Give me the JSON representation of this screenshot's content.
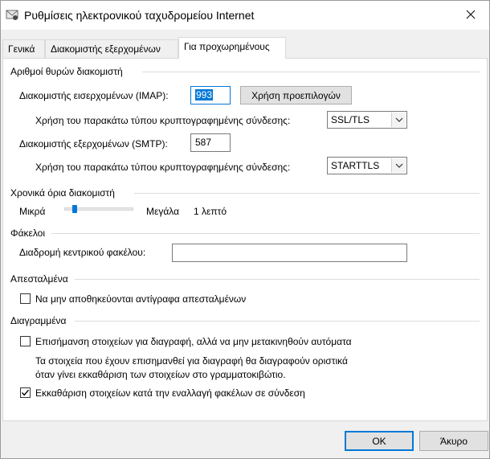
{
  "window": {
    "title": "Ρυθμίσεις ηλεκτρονικού ταχυδρομείου Internet"
  },
  "tabs": [
    {
      "label": "Γενικά",
      "active": false
    },
    {
      "label": "Διακομιστής εξερχομένων",
      "active": false
    },
    {
      "label": "Για προχωρημένους",
      "active": true
    }
  ],
  "ports": {
    "group_title": "Αριθμοί θυρών διακομιστή",
    "imap_label": "Διακομιστής εισερχομένων (IMAP):",
    "imap_value": "993",
    "default_button": "Χρήση προεπιλογών",
    "imap_encryption_label": "Χρήση του παρακάτω τύπου κρυπτογραφημένης σύνδεσης:",
    "imap_encryption_value": "SSL/TLS",
    "smtp_label": "Διακομιστής εξερχομένων (SMTP):",
    "smtp_value": "587",
    "smtp_encryption_label": "Χρήση του παρακάτω τύπου κρυπτογραφημένης σύνδεσης:",
    "smtp_encryption_value": "STARTTLS"
  },
  "timeouts": {
    "group_title": "Χρονικά όρια διακομιστή",
    "short_label": "Μικρά",
    "long_label": "Μεγάλα",
    "value_label": "1 λεπτό",
    "slider_fraction": 0.12
  },
  "folders": {
    "group_title": "Φάκελοι",
    "root_label": "Διαδρομή κεντρικού φακέλου:",
    "root_value": ""
  },
  "sent": {
    "group_title": "Απεσταλμένα",
    "no_copies_label": "Να μην αποθηκεύονται αντίγραφα απεσταλμένων",
    "no_copies_checked": false
  },
  "deleted": {
    "group_title": "Διαγραμμένα",
    "mark_label": "Επισήμανση στοιχείων για διαγραφή, αλλά να μην μετακινηθούν αυτόματα",
    "mark_checked": false,
    "info_line1": "Τα στοιχεία που έχουν επισημανθεί για διαγραφή θα διαγραφούν οριστικά",
    "info_line2": "όταν γίνει εκκαθάριση των στοιχείων στο γραμματοκιβώτιο.",
    "purge_label": "Εκκαθάριση στοιχείων κατά την εναλλαγή φακέλων σε σύνδεση",
    "purge_checked": true
  },
  "footer": {
    "ok_label": "OK",
    "cancel_label": "Άκυρο"
  },
  "colors": {
    "accent": "#0078d7",
    "window_bg": "#f0f0f0",
    "panel_bg": "#ffffff"
  }
}
